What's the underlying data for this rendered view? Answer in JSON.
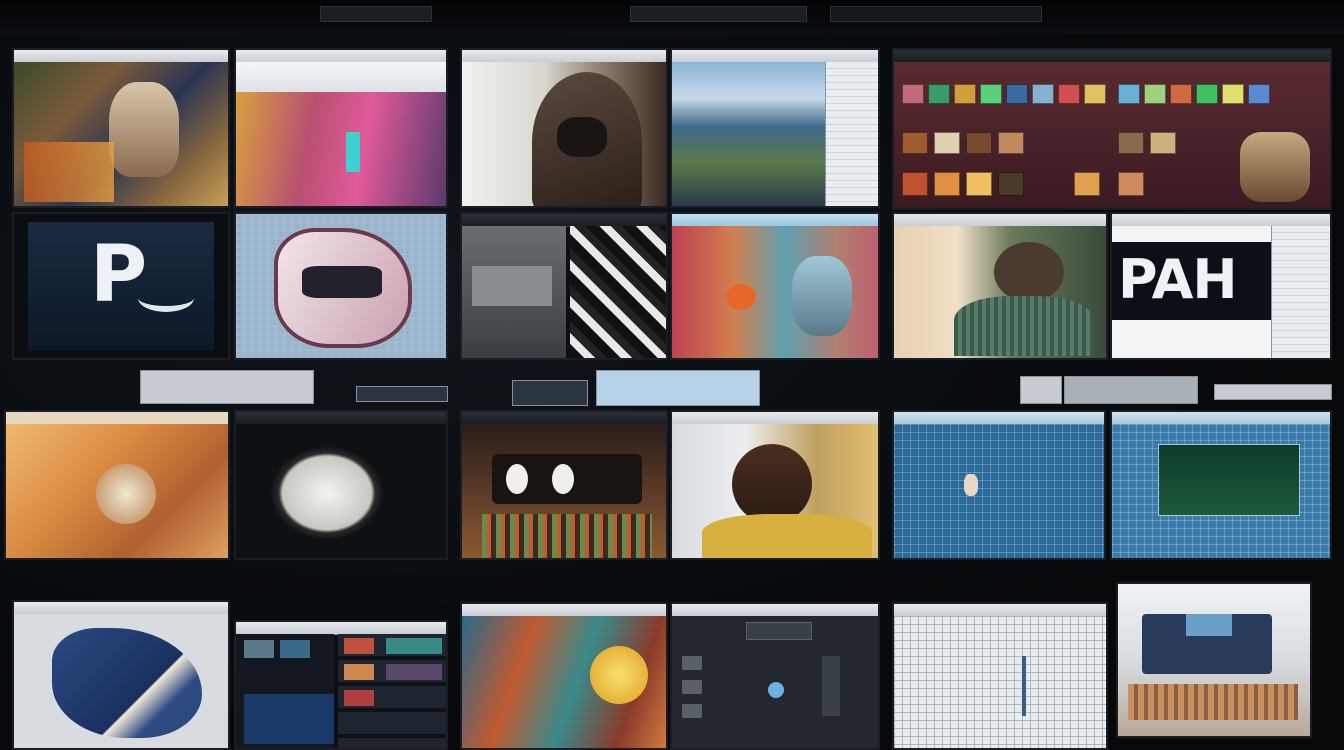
{
  "wall": {
    "screens": [
      {
        "id": "s1",
        "name": "monitor-portrait-illustration",
        "logo": ""
      },
      {
        "id": "s2",
        "name": "monitor-flower-painting",
        "logo": ""
      },
      {
        "id": "s3",
        "name": "monitor-hooded-figure",
        "logo": ""
      },
      {
        "id": "s4",
        "name": "monitor-landscape-editor",
        "logo": ""
      },
      {
        "id": "s5",
        "name": "monitor-thumbnail-gallery",
        "logo": ""
      },
      {
        "id": "s6",
        "name": "monitor-logo-pr",
        "logo": "P"
      },
      {
        "id": "s7",
        "name": "monitor-3d-badge",
        "logo": ""
      },
      {
        "id": "s8",
        "name": "monitor-grayscale-editor",
        "logo": ""
      },
      {
        "id": "s9",
        "name": "monitor-colorful-portrait",
        "logo": ""
      },
      {
        "id": "s10",
        "name": "monitor-drawing-figure",
        "logo": ""
      },
      {
        "id": "s11",
        "name": "monitor-pah-logo",
        "logo": "PAH"
      },
      {
        "id": "s12",
        "name": "monitor-orange-abstract",
        "logo": ""
      },
      {
        "id": "s13",
        "name": "monitor-dark-shell",
        "logo": ""
      },
      {
        "id": "s14",
        "name": "monitor-machine-sculpture",
        "logo": ""
      },
      {
        "id": "s15",
        "name": "monitor-hair-portrait",
        "logo": ""
      },
      {
        "id": "s16",
        "name": "monitor-blueprint-chart",
        "logo": ""
      },
      {
        "id": "s17",
        "name": "monitor-blueprint-scene",
        "logo": ""
      },
      {
        "id": "s18",
        "name": "monitor-3d-model",
        "logo": ""
      },
      {
        "id": "s19",
        "name": "monitor-file-browser",
        "logo": ""
      },
      {
        "id": "s20",
        "name": "monitor-painted-texture",
        "logo": ""
      },
      {
        "id": "s21",
        "name": "monitor-dark-tool-panel",
        "logo": ""
      },
      {
        "id": "s22",
        "name": "monitor-wireframe-grid",
        "logo": ""
      },
      {
        "id": "s23",
        "name": "monitor-interior-render",
        "logo": ""
      }
    ]
  },
  "colors": {
    "background": "#06080a",
    "bezel": "#1a1e24",
    "ui_light": "#e7eaee",
    "ui_dark": "#1a1e24",
    "accent_blue": "#2f6fa8",
    "accent_orange": "#d07a2c"
  }
}
